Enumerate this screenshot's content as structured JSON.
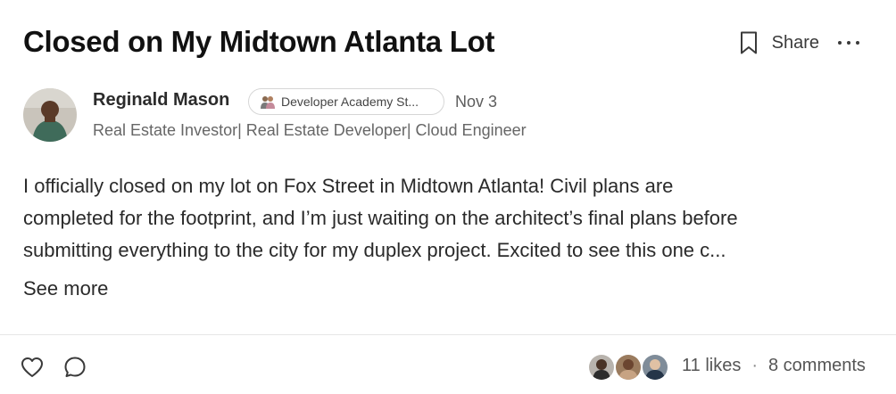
{
  "post": {
    "title": "Closed on My Midtown Atlanta Lot",
    "share_label": "Share",
    "author": {
      "name": "Reginald Mason",
      "badge": "Developer Academy St...",
      "date": "Nov 3",
      "headline": "Real Estate Investor| Real Estate Developer| Cloud Engineer"
    },
    "body_lines": [
      "I officially closed on my lot on Fox Street in Midtown Atlanta! Civil plans are",
      "completed for the footprint, and I’m just waiting on the architect’s final plans before",
      "submitting everything to the city for my duplex project. Excited to see this one c..."
    ],
    "see_more": "See more",
    "likes": "11 likes",
    "separator": "·",
    "comments": "8 comments"
  },
  "icons": [
    "bookmark-icon",
    "more-icon",
    "heart-icon",
    "comment-icon"
  ],
  "colors": {
    "text": "#1f1f1f",
    "muted": "#666666",
    "border": "#d6d6d6"
  }
}
